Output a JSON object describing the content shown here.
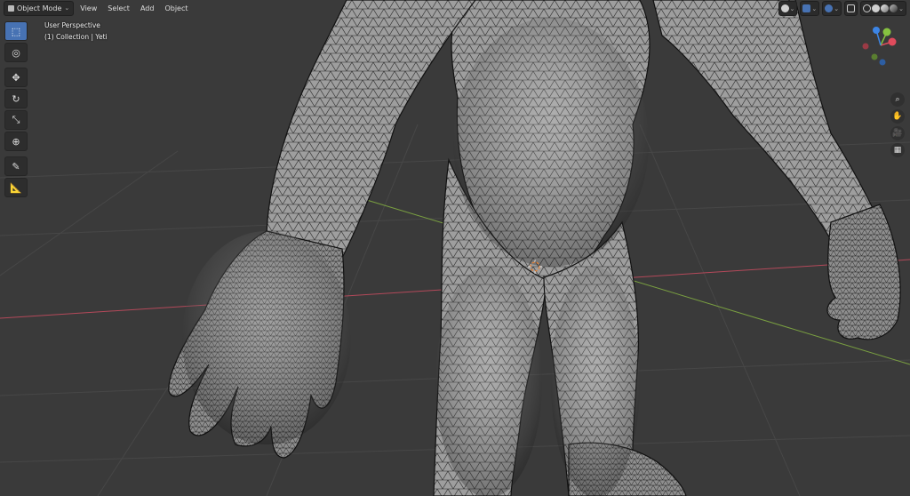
{
  "header": {
    "mode_label": "Object Mode",
    "menu": [
      "View",
      "Select",
      "Add",
      "Object"
    ]
  },
  "viewport": {
    "perspective_label": "User Perspective",
    "collection_label": "(1) Collection | Yeti"
  },
  "toolbar": {
    "tools": [
      {
        "name": "select-box",
        "glyph": "⬚",
        "active": true
      },
      {
        "name": "cursor",
        "glyph": "◎",
        "active": false
      },
      {
        "name": "move",
        "glyph": "✥",
        "active": false
      },
      {
        "name": "rotate",
        "glyph": "↻",
        "active": false
      },
      {
        "name": "scale",
        "glyph": "⤡",
        "active": false
      },
      {
        "name": "transform",
        "glyph": "⊕",
        "active": false
      },
      {
        "name": "annotate",
        "glyph": "✎",
        "active": false
      },
      {
        "name": "measure",
        "glyph": "📐",
        "active": false
      }
    ]
  },
  "navigation": {
    "zoom_glyph": "⌕",
    "pan_glyph": "✋",
    "camera_glyph": "🎥",
    "grid_glyph": "▦"
  },
  "colors": {
    "viewport_bg": "#3a3a3a",
    "grid_line": "#454545",
    "x_axis": "#b4495a",
    "y_axis": "#7aa041",
    "active_tool": "#4772b3",
    "mesh_fill": "#9a9a9a",
    "mesh_wire": "#222222",
    "gizmo_x": "#e04b5c",
    "gizmo_y": "#86c240",
    "gizmo_z": "#3c85e6"
  }
}
